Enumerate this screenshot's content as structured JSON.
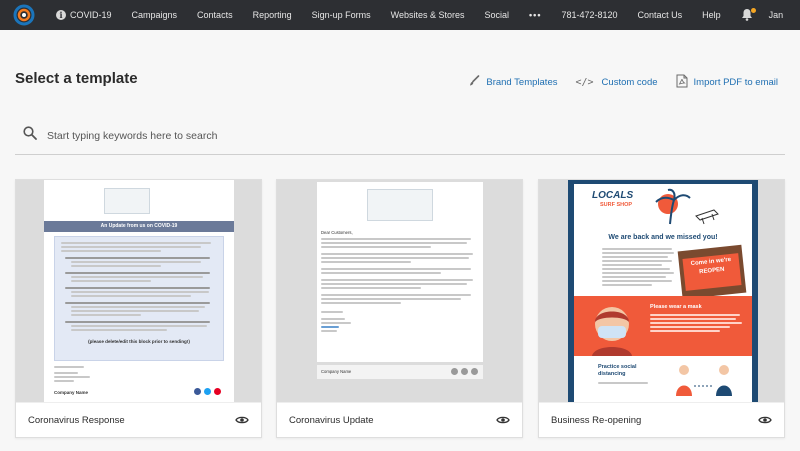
{
  "nav": {
    "items": [
      "COVID-19",
      "Campaigns",
      "Contacts",
      "Reporting",
      "Sign-up Forms",
      "Websites & Stores",
      "Social",
      "•••",
      "781-472-8120",
      "Contact Us",
      "Help"
    ],
    "user_initial": "Jan"
  },
  "header": {
    "title": "Select a template",
    "actions": {
      "brand_templates": "Brand Templates",
      "custom_code": "Custom code",
      "import_pdf": "Import PDF to email"
    }
  },
  "search": {
    "placeholder": "Start typing keywords here to search"
  },
  "cards": [
    {
      "name": "Coronavirus Response",
      "preview": {
        "banner": "An Update from us on COVID-19",
        "closing": "(please delete/edit this block prior to sending!)",
        "footer": "Company Name"
      }
    },
    {
      "name": "Coronavirus Update",
      "preview": {
        "greeting": "Dear Customers,",
        "footer": "Company Name"
      }
    },
    {
      "name": "Business Re-opening",
      "preview": {
        "brand_top": "LOCALS",
        "brand_bottom": "SURF SHOP",
        "headline": "We are back and we missed you!",
        "sign": "Come in we're REOPEN",
        "mask_title": "Please wear a mask",
        "distancing_title": "Practice social distancing"
      }
    }
  ],
  "colors": {
    "nav_bg": "#2d2f33",
    "link": "#1f6fb2",
    "covid_banner": "#6b7a99",
    "covid_panel": "#e3e9f5",
    "reopen_navy": "#1e4a73",
    "reopen_orange": "#f05a3a"
  }
}
